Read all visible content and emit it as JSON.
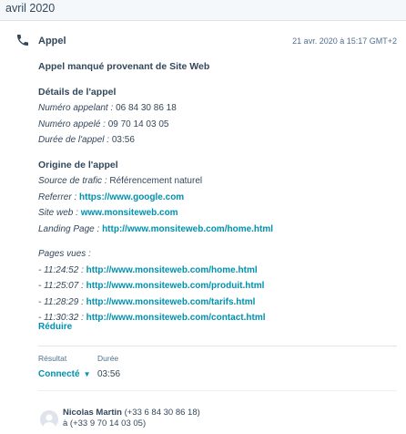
{
  "month_header": "avril 2020",
  "activity": {
    "type": "Appel",
    "date": "21 avr. 2020 à 15:17 GMT+2",
    "icon": "phone-icon",
    "headline": "Appel manqué provenant de Site Web",
    "details": {
      "title": "Détails de l'appel",
      "caller_label": "Numéro appelant :",
      "caller_value": "06 84 30 86 18",
      "called_label": "Numéro appelé :",
      "called_value": "09 70 14 03 05",
      "duration_label": "Durée de l'appel :",
      "duration_value": "03:56"
    },
    "origin": {
      "title": "Origine de l'appel",
      "traffic_label": "Source de trafic :",
      "traffic_value": "Référencement naturel",
      "referrer_label": "Referrer :",
      "referrer_value": "https://www.google.com",
      "site_label": "Site web :",
      "site_value": "www.monsiteweb.com",
      "landing_label": "Landing Page :",
      "landing_value": "http://www.monsiteweb.com/home.html"
    },
    "pages": {
      "title": "Pages vues :",
      "items": [
        {
          "prefix": "- 11:24:52 :",
          "url": "http://www.monsiteweb.com/home.html"
        },
        {
          "prefix": "- 11:25:07 :",
          "url": "http://www.monsiteweb.com/produit.html"
        },
        {
          "prefix": "- 11:28:29 :",
          "url": "http://www.monsiteweb.com/tarifs.html"
        },
        {
          "prefix": "- 11:30:32 :",
          "url": "http://www.monsiteweb.com/contact.html"
        }
      ]
    },
    "reduce_label": "Réduire",
    "result": {
      "result_label": "Résultat",
      "result_value": "Connecté",
      "duration_label": "Durée",
      "duration_value": "03:56"
    },
    "participant": {
      "name": "Nicolas Martin",
      "from_number": "(+33 6 84 30 86 18)",
      "to_line": "à (+33 9 70 14 03 05)"
    }
  },
  "colors": {
    "accent": "#0091ae",
    "text": "#33475b",
    "muted": "#516f90",
    "background": "#f5f8fa"
  }
}
